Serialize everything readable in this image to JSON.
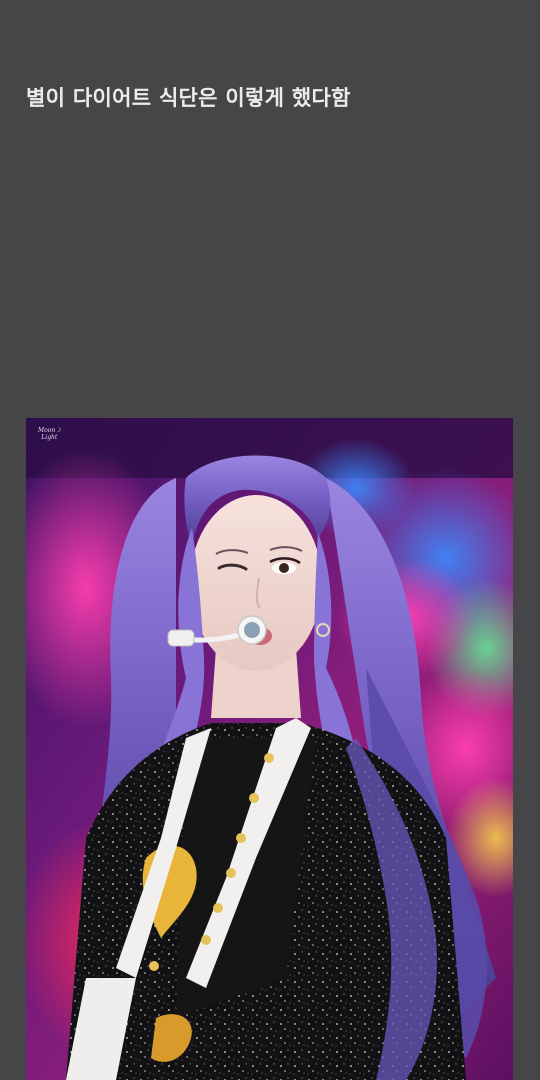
{
  "post": {
    "title": "별이 다이어트 식단은 이렇게 했다함"
  },
  "photo": {
    "subject": "concert photo of a performer with long lavender hair wearing a headset microphone and sparkly black jacket",
    "watermark": {
      "line1": "Moon☽",
      "line2": "Light"
    }
  },
  "colors": {
    "background": "#464648",
    "title_text": "#ececec"
  }
}
